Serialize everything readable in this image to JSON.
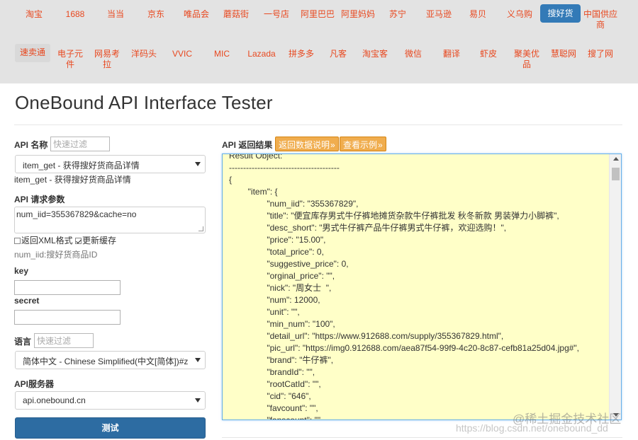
{
  "nav": {
    "row1": [
      "淘宝",
      "1688",
      "当当",
      "京东",
      "唯品会",
      "蘑菇街",
      "一号店",
      "阿里巴巴",
      "阿里妈妈",
      "苏宁",
      "亚马逊",
      "易贝",
      "义乌购",
      "搜好货",
      "中国供应\n商"
    ],
    "row2": [
      "速卖通",
      "电子元\n件",
      "网易考\n拉",
      "洋码头",
      "VVIC",
      "MIC",
      "Lazada",
      "拼多多",
      "凡客",
      "淘宝客",
      "微信",
      "翻译",
      "虾皮",
      "聚美优\n品",
      "慧聪网",
      "搜了网"
    ],
    "active": "搜好货",
    "current": "速卖通"
  },
  "page_title": "OneBound API Interface Tester",
  "api_name": {
    "label": "API 名称",
    "filter_placeholder": "快速过滤",
    "selected": "item_get - 获得搜好货商品详情",
    "description": "item_get - 获得搜好货商品详情"
  },
  "params": {
    "label": "API 请求参数",
    "value": "num_iid=355367829&cache=no",
    "checkbox_xml": "返回XML格式",
    "checkbox_xml_checked": false,
    "checkbox_refresh": "更新缓存",
    "checkbox_refresh_checked": true,
    "hint": "num_iid:搜好货商品ID"
  },
  "key_label": "key",
  "secret_label": "secret",
  "language": {
    "label": "语言",
    "filter_placeholder": "快速过滤",
    "selected": "简体中文 - Chinese Simplified(中文[简体])#z"
  },
  "server": {
    "label": "API服务器",
    "selected": "api.onebound.cn"
  },
  "test_button": "测试",
  "result": {
    "label": "API 返回结果",
    "doc_button": "返回数据说明",
    "example_button": "查看示例",
    "lines": [
      "Result Object:",
      "---------------------------------------",
      "{",
      "        \"item\": {",
      "                \"num_iid\": \"355367829\",",
      "                \"title\": \"便宜库存男式牛仔裤地摊货杂款牛仔裤批发 秋冬新款 男装弹力小脚裤\",",
      "                \"desc_short\": \"男式牛仔裤产品牛仔裤男式牛仔裤，欢迎选购！\",",
      "                \"price\": \"15.00\",",
      "                \"total_price\": 0,",
      "                \"suggestive_price\": 0,",
      "                \"orginal_price\": \"\",",
      "                \"nick\": \"周女士  \",",
      "                \"num\": 12000,",
      "                \"unit\": \"\",",
      "                \"min_num\": \"100\",",
      "                \"detail_url\": \"https://www.912688.com/supply/355367829.html\",",
      "                \"pic_url\": \"https://img0.912688.com/aea87f54-99f9-4c20-8c87-cefb81a25d04.jpg#\",",
      "                \"brand\": \"牛仔裤\",",
      "                \"brandId\": \"\",",
      "                \"rootCatId\": \"\",",
      "                \"cid\": \"646\",",
      "                \"favcount\": \"\",",
      "                \"fanscount\": \"\""
    ]
  },
  "watermark": {
    "line1": "@稀土掘金技术社区",
    "line2": "https://blog.csdn.net/onebound_dd"
  }
}
